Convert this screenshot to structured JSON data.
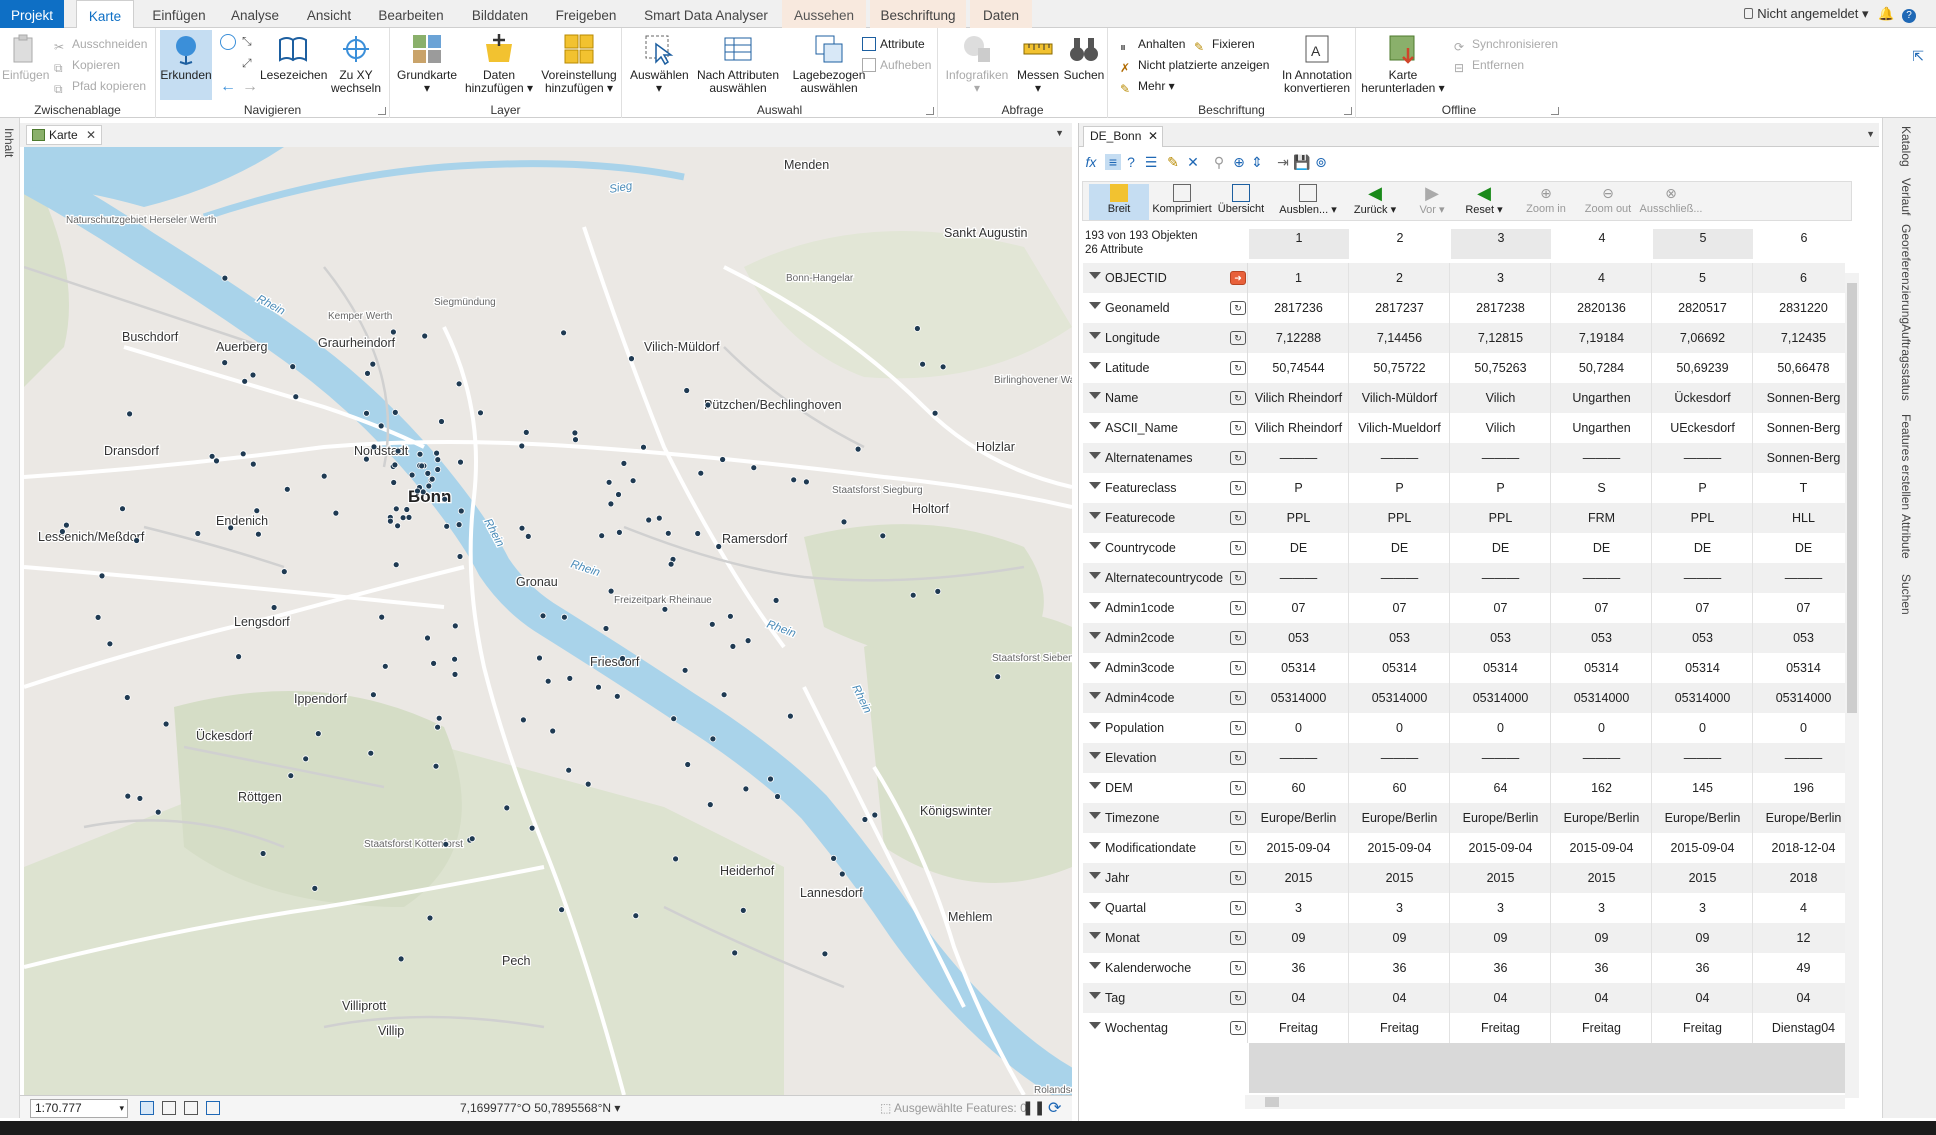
{
  "ribbon_tabs": [
    "Projekt",
    "Karte",
    "Einfügen",
    "Analyse",
    "Ansicht",
    "Bearbeiten",
    "Bilddaten",
    "Freigeben",
    "Smart Data Analyser",
    "Aussehen",
    "Beschriftung",
    "Daten"
  ],
  "user": {
    "status": "Nicht angemeldet"
  },
  "groups": {
    "zwischenablage": {
      "label": "Zwischenablage",
      "einfuegen": "Einfügen",
      "ausschneiden": "Ausschneiden",
      "kopieren": "Kopieren",
      "pfad": "Pfad kopieren"
    },
    "navigieren": {
      "label": "Navigieren",
      "erkunden": "Erkunden",
      "lesezeichen": "Lesezeichen",
      "zuxy1": "Zu XY",
      "zuxy2": "wechseln"
    },
    "layer": {
      "label": "Layer",
      "grundkarte": "Grundkarte",
      "daten1": "Daten",
      "daten2": "hinzufügen",
      "vor1": "Voreinstellung",
      "vor2": "hinzufügen"
    },
    "auswahl": {
      "label": "Auswahl",
      "auswaehlen": "Auswählen",
      "nach1": "Nach Attributen",
      "nach2": "auswählen",
      "lage1": "Lagebezogen",
      "lage2": "auswählen",
      "attribute": "Attribute",
      "aufheben": "Aufheben"
    },
    "abfrage": {
      "label": "Abfrage",
      "info": "Infografiken",
      "messen": "Messen",
      "suchen": "Suchen"
    },
    "beschriftung": {
      "label": "Beschriftung",
      "anhalten": "Anhalten",
      "fixieren": "Fixieren",
      "nicht": "Nicht platzierte anzeigen",
      "mehr": "Mehr",
      "anno1": "In Annotation",
      "anno2": "konvertieren"
    },
    "offline": {
      "label": "Offline",
      "karte1": "Karte",
      "karte2": "herunterladen",
      "sync": "Synchronisieren",
      "entfernen": "Entfernen"
    }
  },
  "left_panel": "Inhalt",
  "map": {
    "tab": "Karte",
    "scale": "1:70.777",
    "coords": "7,1699777°O 50,7895568°N",
    "selected": "Ausgewählte Features: 0",
    "labels": [
      {
        "t": "Menden",
        "k": "town"
      },
      {
        "t": "Sankt Augustin",
        "k": "town"
      },
      {
        "t": "Vilich-Müldorf",
        "k": "town"
      },
      {
        "t": "Pützchen/Bechlinghoven",
        "k": "town"
      },
      {
        "t": "Holzlar",
        "k": "town"
      },
      {
        "t": "Holtorf",
        "k": "town"
      },
      {
        "t": "Ramersdorf",
        "k": "town"
      },
      {
        "t": "Graurheindorf",
        "k": "town"
      },
      {
        "t": "Buschdorf",
        "k": "town"
      },
      {
        "t": "Auerberg",
        "k": "town"
      },
      {
        "t": "Dransdorf",
        "k": "town"
      },
      {
        "t": "Nordstadt",
        "k": "town"
      },
      {
        "t": "Bonn",
        "k": "city"
      },
      {
        "t": "Endenich",
        "k": "town"
      },
      {
        "t": "Lessenich/Meßdorf",
        "k": "town"
      },
      {
        "t": "Gronau",
        "k": "town"
      },
      {
        "t": "Lengsdorf",
        "k": "town"
      },
      {
        "t": "Friesdorf",
        "k": "town"
      },
      {
        "t": "Ippendorf",
        "k": "town"
      },
      {
        "t": "Ückesdorf",
        "k": "town"
      },
      {
        "t": "Röttgen",
        "k": "town"
      },
      {
        "t": "Königswinter",
        "k": "town"
      },
      {
        "t": "Heiderhof",
        "k": "town"
      },
      {
        "t": "Lannesdorf",
        "k": "town"
      },
      {
        "t": "Mehlem",
        "k": "town"
      },
      {
        "t": "Pech",
        "k": "town"
      },
      {
        "t": "Villiprott",
        "k": "town"
      },
      {
        "t": "Villip",
        "k": "town"
      },
      {
        "t": "Siegmündung",
        "k": "small"
      },
      {
        "t": "Naturschutzgebiet Herseler Werth",
        "k": "small"
      },
      {
        "t": "Kemper Werth",
        "k": "small"
      },
      {
        "t": "Bonn-Hangelar",
        "k": "small"
      },
      {
        "t": "Birlinghovener Wald",
        "k": "small"
      },
      {
        "t": "Staatsforst Siegburg",
        "k": "small"
      },
      {
        "t": "Freizeitpark Rheinaue",
        "k": "small"
      },
      {
        "t": "Staatsforst Siebengebirge",
        "k": "small"
      },
      {
        "t": "Staatsforst Kottenforst",
        "k": "small"
      },
      {
        "t": "Rhein",
        "k": "water"
      },
      {
        "t": "Rhein",
        "k": "water"
      },
      {
        "t": "Rhein",
        "k": "water"
      },
      {
        "t": "Rhein",
        "k": "water"
      },
      {
        "t": "Rhein",
        "k": "water"
      },
      {
        "t": "Sieg",
        "k": "water"
      },
      {
        "t": "Rolandseck",
        "k": "small"
      }
    ]
  },
  "attr_pane": {
    "tab": "DE_Bonn",
    "buttons": [
      "Breit",
      "Komprimiert",
      "Übersicht",
      "Ausblen...",
      "Zurück",
      "Vor",
      "Reset",
      "Zoom in",
      "Zoom out",
      "Ausschließ..."
    ],
    "count_line1": "193 von 193 Objekten",
    "count_line2": "26 Attribute",
    "columns": [
      "1",
      "2",
      "3",
      "4",
      "5",
      "6"
    ],
    "rows": [
      {
        "f": "OBJECTID",
        "v": [
          "1",
          "2",
          "3",
          "4",
          "5",
          "6"
        ]
      },
      {
        "f": "Geonameld",
        "v": [
          "2817236",
          "2817237",
          "2817238",
          "2820136",
          "2820517",
          "2831220"
        ]
      },
      {
        "f": "Longitude",
        "v": [
          "7,12288",
          "7,14456",
          "7,12815",
          "7,19184",
          "7,06692",
          "7,12435"
        ]
      },
      {
        "f": "Latitude",
        "v": [
          "50,74544",
          "50,75722",
          "50,75263",
          "50,7284",
          "50,69239",
          "50,66478"
        ]
      },
      {
        "f": "Name",
        "v": [
          "Vilich Rheindorf",
          "Vilich-Müldorf",
          "Vilich",
          "Ungarthen",
          "Ückesdorf",
          "Sonnen-Berg"
        ]
      },
      {
        "f": "ASCII_Name",
        "v": [
          "Vilich Rheindorf",
          "Vilich-Mueldorf",
          "Vilich",
          "Ungarthen",
          "UEckesdorf",
          "Sonnen-Berg"
        ]
      },
      {
        "f": "Alternatenames",
        "v": [
          "———",
          "———",
          "———",
          "———",
          "———",
          "Sonnen-Berg"
        ]
      },
      {
        "f": "Featureclass",
        "v": [
          "P",
          "P",
          "P",
          "S",
          "P",
          "T"
        ]
      },
      {
        "f": "Featurecode",
        "v": [
          "PPL",
          "PPL",
          "PPL",
          "FRM",
          "PPL",
          "HLL"
        ]
      },
      {
        "f": "Countrycode",
        "v": [
          "DE",
          "DE",
          "DE",
          "DE",
          "DE",
          "DE"
        ]
      },
      {
        "f": "Alternatecountrycode",
        "v": [
          "———",
          "———",
          "———",
          "———",
          "———",
          "———"
        ]
      },
      {
        "f": "Admin1code",
        "v": [
          "07",
          "07",
          "07",
          "07",
          "07",
          "07"
        ]
      },
      {
        "f": "Admin2code",
        "v": [
          "053",
          "053",
          "053",
          "053",
          "053",
          "053"
        ]
      },
      {
        "f": "Admin3code",
        "v": [
          "05314",
          "05314",
          "05314",
          "05314",
          "05314",
          "05314"
        ]
      },
      {
        "f": "Admin4code",
        "v": [
          "05314000",
          "05314000",
          "05314000",
          "05314000",
          "05314000",
          "05314000"
        ]
      },
      {
        "f": "Population",
        "v": [
          "0",
          "0",
          "0",
          "0",
          "0",
          "0"
        ]
      },
      {
        "f": "Elevation",
        "v": [
          "———",
          "———",
          "———",
          "———",
          "———",
          "———"
        ]
      },
      {
        "f": "DEM",
        "v": [
          "60",
          "60",
          "64",
          "162",
          "145",
          "196"
        ]
      },
      {
        "f": "Timezone",
        "v": [
          "Europe/Berlin",
          "Europe/Berlin",
          "Europe/Berlin",
          "Europe/Berlin",
          "Europe/Berlin",
          "Europe/Berlin"
        ]
      },
      {
        "f": "Modificationdate",
        "v": [
          "2015-09-04",
          "2015-09-04",
          "2015-09-04",
          "2015-09-04",
          "2015-09-04",
          "2018-12-04"
        ]
      },
      {
        "f": "Jahr",
        "v": [
          "2015",
          "2015",
          "2015",
          "2015",
          "2015",
          "2018"
        ]
      },
      {
        "f": "Quartal",
        "v": [
          "3",
          "3",
          "3",
          "3",
          "3",
          "4"
        ]
      },
      {
        "f": "Monat",
        "v": [
          "09",
          "09",
          "09",
          "09",
          "09",
          "12"
        ]
      },
      {
        "f": "Kalenderwoche",
        "v": [
          "36",
          "36",
          "36",
          "36",
          "36",
          "49"
        ]
      },
      {
        "f": "Tag",
        "v": [
          "04",
          "04",
          "04",
          "04",
          "04",
          "04"
        ]
      },
      {
        "f": "Wochentag",
        "v": [
          "Freitag",
          "Freitag",
          "Freitag",
          "Freitag",
          "Freitag",
          "Dienstag04"
        ]
      }
    ]
  },
  "right_panels": [
    "Katalog",
    "Verlauf",
    "Georeferenzierung",
    "Auftragsstatus",
    "Features erstellen",
    "Attribute",
    "Suchen"
  ],
  "colors": {
    "accent": "#0e6fc5",
    "water": "#a9d3ea",
    "land": "#e9e6e2",
    "forest": "#d3dcc4",
    "point": "#1f3a52"
  }
}
